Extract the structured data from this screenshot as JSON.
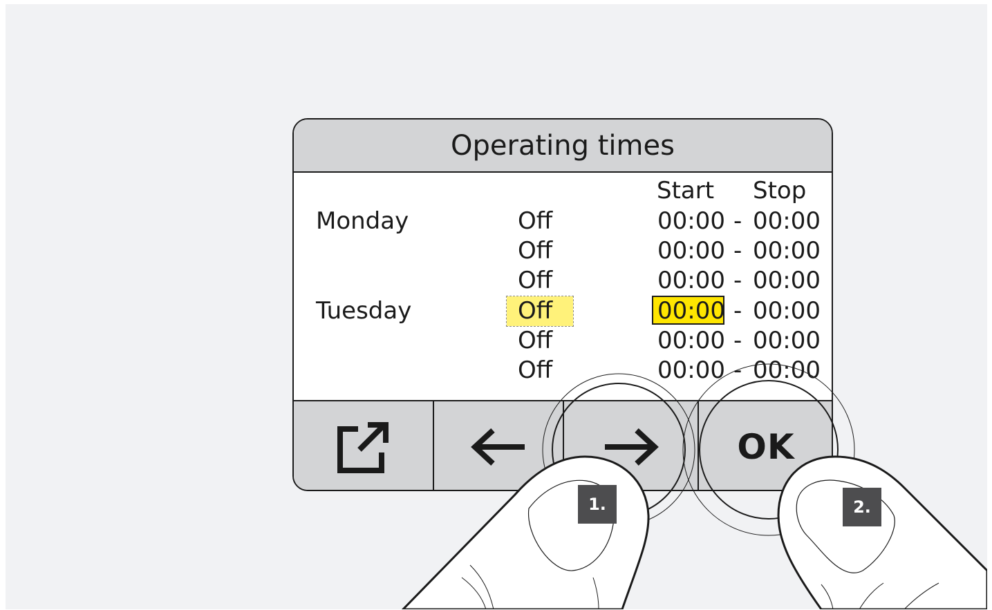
{
  "screen": {
    "title": "Operating times"
  },
  "columns": {
    "start": "Start",
    "stop": "Stop"
  },
  "days": [
    {
      "name": "Monday",
      "rows": [
        {
          "mode": "Off",
          "start": "00:00",
          "sep": "-",
          "stop": "00:00"
        },
        {
          "mode": "Off",
          "start": "00:00",
          "sep": "-",
          "stop": "00:00"
        },
        {
          "mode": "Off",
          "start": "00:00",
          "sep": "-",
          "stop": "00:00"
        }
      ]
    },
    {
      "name": "Tuesday",
      "rows": [
        {
          "mode": "Off",
          "start": "00:00",
          "sep": "-",
          "stop": "00:00",
          "selected": true
        },
        {
          "mode": "Off",
          "start": "00:00",
          "sep": "-",
          "stop": "00:00"
        },
        {
          "mode": "Off",
          "start": "00:00",
          "sep": "-",
          "stop": "00:00"
        }
      ]
    }
  ],
  "toolbar": {
    "export_icon": "external-link-icon",
    "back_icon": "arrow-left-icon",
    "forward_icon": "arrow-right-icon",
    "ok_label": "OK"
  },
  "instructions": {
    "step1": "1.",
    "step2": "2."
  },
  "colors": {
    "highlight_selection": "#fff27a",
    "highlight_active": "#ffe600",
    "panel_gray": "#d3d4d6",
    "badge_gray": "#4d4d4f"
  }
}
